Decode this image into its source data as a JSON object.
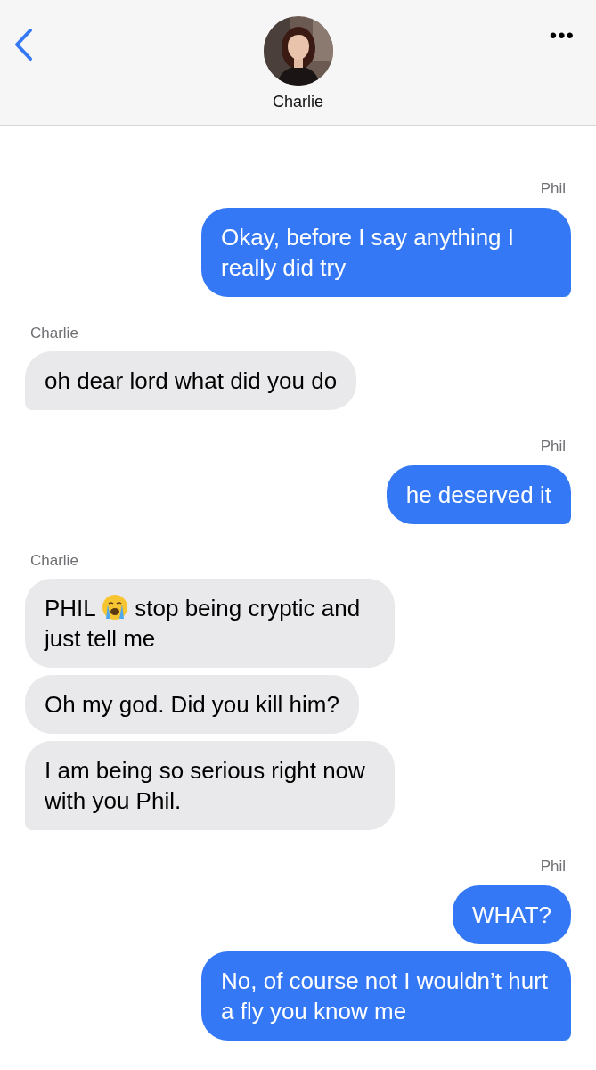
{
  "header": {
    "contact_name": "Charlie",
    "more": "•••"
  },
  "groups": [
    {
      "sender": "Phil",
      "kind": "sent",
      "messages": [
        {
          "segments": [
            {
              "kind": "text",
              "text": "Okay, before I say anything I really did try"
            }
          ]
        }
      ]
    },
    {
      "sender": "Charlie",
      "kind": "received",
      "messages": [
        {
          "segments": [
            {
              "kind": "text",
              "text": "oh dear lord what did you do"
            }
          ]
        }
      ]
    },
    {
      "sender": "Phil",
      "kind": "sent",
      "messages": [
        {
          "segments": [
            {
              "kind": "text",
              "text": "he deserved it"
            }
          ]
        }
      ]
    },
    {
      "sender": "Charlie",
      "kind": "received",
      "messages": [
        {
          "segments": [
            {
              "kind": "text",
              "text": "PHIL "
            },
            {
              "kind": "emoji"
            },
            {
              "kind": "text",
              "text": " stop being cryptic and just tell me"
            }
          ]
        },
        {
          "segments": [
            {
              "kind": "text",
              "text": "Oh my god. Did you kill him?"
            }
          ]
        },
        {
          "segments": [
            {
              "kind": "text",
              "text": "I am being so serious right now with you Phil."
            }
          ]
        }
      ]
    },
    {
      "sender": "Phil",
      "kind": "sent",
      "messages": [
        {
          "segments": [
            {
              "kind": "text",
              "text": "WHAT?"
            }
          ]
        },
        {
          "segments": [
            {
              "kind": "text",
              "text": "No, of course not I wouldn’t hurt a fly you know me"
            }
          ]
        }
      ]
    }
  ]
}
